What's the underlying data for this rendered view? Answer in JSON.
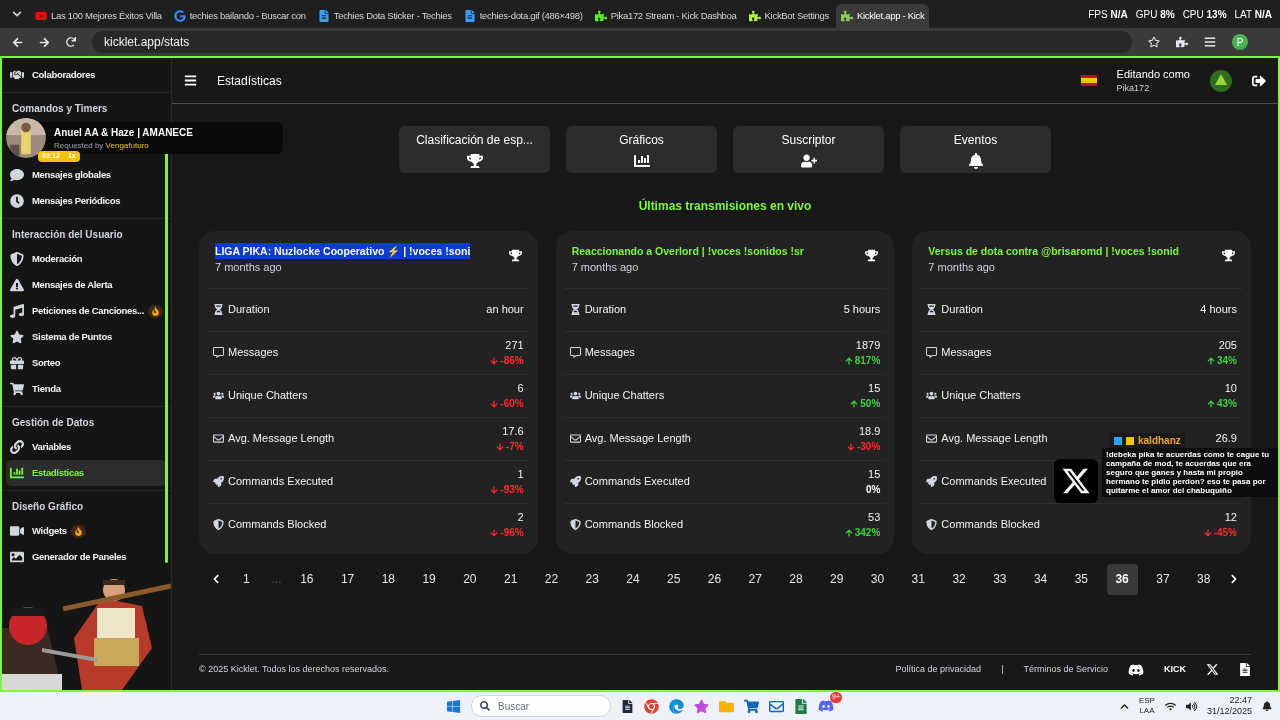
{
  "browser": {
    "tabs": [
      {
        "title": "Las 100 Mejores Éxitos Villa",
        "selected": false
      },
      {
        "title": "techies bailando - Buscar con",
        "selected": false
      },
      {
        "title": "Techies Dota Sticker - Techies",
        "selected": false
      },
      {
        "title": "techies-dota.gif (486×498)",
        "selected": false
      },
      {
        "title": "Pika172 Stream - Kick Dashboa",
        "selected": false
      },
      {
        "title": "KickBot Settings",
        "selected": false
      },
      {
        "title": "Kicklet.app - Kick",
        "selected": true
      }
    ],
    "address": "kicklet.app/stats",
    "profile": "P"
  },
  "perf_overlay": [
    {
      "label": "FPS",
      "value": "N/A"
    },
    {
      "label": "GPU",
      "value": "8%"
    },
    {
      "label": "CPU",
      "value": "13%"
    },
    {
      "label": "LAT",
      "value": "N/A"
    }
  ],
  "sidebar": {
    "sections": [
      {
        "items": [
          {
            "label": "Colaboradores",
            "selected": false,
            "hot": false
          }
        ]
      },
      {
        "title": "Comandos y Timers",
        "items": [
          {
            "label": "Mensajes globales",
            "selected": false,
            "hot": false
          },
          {
            "label": "Mensajes Periódicos",
            "selected": false,
            "hot": false
          }
        ]
      },
      {
        "title": "Interacción del Usuario",
        "items": [
          {
            "label": "Moderación",
            "selected": false,
            "hot": false
          },
          {
            "label": "Mensajes de Alerta",
            "selected": false,
            "hot": false
          },
          {
            "label": "Peticiones de Canciones...",
            "selected": false,
            "hot": true
          },
          {
            "label": "Sistema de Puntos",
            "selected": false,
            "hot": false
          },
          {
            "label": "Sorteo",
            "selected": false,
            "hot": false
          },
          {
            "label": "Tienda",
            "selected": false,
            "hot": false
          }
        ]
      },
      {
        "title": "Gestión de Datos",
        "items": [
          {
            "label": "Variables",
            "selected": false,
            "hot": false
          },
          {
            "label": "Estadísticas",
            "selected": true,
            "hot": false
          }
        ]
      },
      {
        "title": "Diseño Gráfico",
        "items": [
          {
            "label": "Widgets",
            "selected": false,
            "hot": true
          },
          {
            "label": "Generador de Paneles",
            "selected": false,
            "hot": false
          }
        ]
      }
    ]
  },
  "song_widget": {
    "title": "Anuel AA & Haze | AMANECE",
    "requested_prefix": "Requested by",
    "requester": "Vengafuturo",
    "time": "03:12",
    "speed": "1x"
  },
  "header": {
    "title": "Estadísticas",
    "editing_label": "Editando como",
    "user": "Pika172"
  },
  "stat_buttons": [
    {
      "label": "Clasificación de esp..."
    },
    {
      "label": "Gráficos"
    },
    {
      "label": "Suscriptor"
    },
    {
      "label": "Eventos"
    }
  ],
  "section_title": "Últimas transmisiones en vivo",
  "streams": [
    {
      "title": "LIGA PIKA: Nuzlocke Cooperativo ⚡ | !voces !soni",
      "highlighted": true,
      "age": "7 months ago",
      "metrics": [
        {
          "label": "Duration",
          "value": "an hour"
        },
        {
          "label": "Messages",
          "value": "271",
          "change": "-86%",
          "kind": "down"
        },
        {
          "label": "Unique Chatters",
          "value": "6",
          "change": "-60%",
          "kind": "down"
        },
        {
          "label": "Avg. Message Length",
          "value": "17.6",
          "change": "-7%",
          "kind": "down"
        },
        {
          "label": "Commands Executed",
          "value": "1",
          "change": "-93%",
          "kind": "down"
        },
        {
          "label": "Commands Blocked",
          "value": "2",
          "change": "-96%",
          "kind": "down"
        }
      ]
    },
    {
      "title": "Reaccionando a Overlord | !voces !sonidos !sr",
      "highlighted": false,
      "age": "7 months ago",
      "metrics": [
        {
          "label": "Duration",
          "value": "5 hours"
        },
        {
          "label": "Messages",
          "value": "1879",
          "change": "817%",
          "kind": "up"
        },
        {
          "label": "Unique Chatters",
          "value": "15",
          "change": "50%",
          "kind": "up"
        },
        {
          "label": "Avg. Message Length",
          "value": "18.9",
          "change": "-30%",
          "kind": "down"
        },
        {
          "label": "Commands Executed",
          "value": "15",
          "change": "0%",
          "kind": "flat"
        },
        {
          "label": "Commands Blocked",
          "value": "53",
          "change": "342%",
          "kind": "up"
        }
      ]
    },
    {
      "title": "Versus de dota contra @brisaromd | !voces !sonid",
      "highlighted": false,
      "age": "7 months ago",
      "metrics": [
        {
          "label": "Duration",
          "value": "4 hours"
        },
        {
          "label": "Messages",
          "value": "205",
          "change": "34%",
          "kind": "up"
        },
        {
          "label": "Unique Chatters",
          "value": "10",
          "change": "43%",
          "kind": "up"
        },
        {
          "label": "Avg. Message Length",
          "value": "26.9"
        },
        {
          "label": "Commands Executed"
        },
        {
          "label": "Commands Blocked",
          "value": "12",
          "change": "-45%",
          "kind": "down"
        }
      ]
    }
  ],
  "chat_overlay": {
    "user": "kaldhanz",
    "message": "!debeka pika te acuerdas como te cague tu campaña de mod, te acuerdas que era seguro que ganes y hasta mi propio hermano te pidio perdon? eso te pasa por quitarme el amor del chabuquiño"
  },
  "pagination": [
    {
      "label": "1",
      "kind": "page",
      "selected": false
    },
    {
      "label": "...",
      "kind": "gap"
    },
    {
      "label": "16",
      "kind": "page",
      "selected": false
    },
    {
      "label": "17",
      "kind": "page",
      "selected": false
    },
    {
      "label": "18",
      "kind": "page",
      "selected": false
    },
    {
      "label": "19",
      "kind": "page",
      "selected": false
    },
    {
      "label": "20",
      "kind": "page",
      "selected": false
    },
    {
      "label": "21",
      "kind": "page",
      "selected": false
    },
    {
      "label": "22",
      "kind": "page",
      "selected": false
    },
    {
      "label": "23",
      "kind": "page",
      "selected": false
    },
    {
      "label": "24",
      "kind": "page",
      "selected": false
    },
    {
      "label": "25",
      "kind": "page",
      "selected": false
    },
    {
      "label": "26",
      "kind": "page",
      "selected": false
    },
    {
      "label": "27",
      "kind": "page",
      "selected": false
    },
    {
      "label": "28",
      "kind": "page",
      "selected": false
    },
    {
      "label": "29",
      "kind": "page",
      "selected": false
    },
    {
      "label": "30",
      "kind": "page",
      "selected": false
    },
    {
      "label": "31",
      "kind": "page",
      "selected": false
    },
    {
      "label": "32",
      "kind": "page",
      "selected": false
    },
    {
      "label": "33",
      "kind": "page",
      "selected": false
    },
    {
      "label": "34",
      "kind": "page",
      "selected": false
    },
    {
      "label": "35",
      "kind": "page",
      "selected": false
    },
    {
      "label": "36",
      "kind": "page",
      "selected": true
    },
    {
      "label": "37",
      "kind": "page",
      "selected": false
    },
    {
      "label": "38",
      "kind": "page",
      "selected": false
    }
  ],
  "footer": {
    "copyright": "© 2025 Kicklet. Todos los derechos reservados.",
    "links": [
      "Política de privacidad",
      "Términos de Servicio"
    ],
    "separator": "|",
    "kick_logo": "KICK"
  },
  "taskbar": {
    "search_placeholder": "Buscar",
    "language": [
      "ESP",
      "LAA"
    ],
    "time": "22:47",
    "date": "31/12/2025",
    "discord_badge": "9+"
  }
}
